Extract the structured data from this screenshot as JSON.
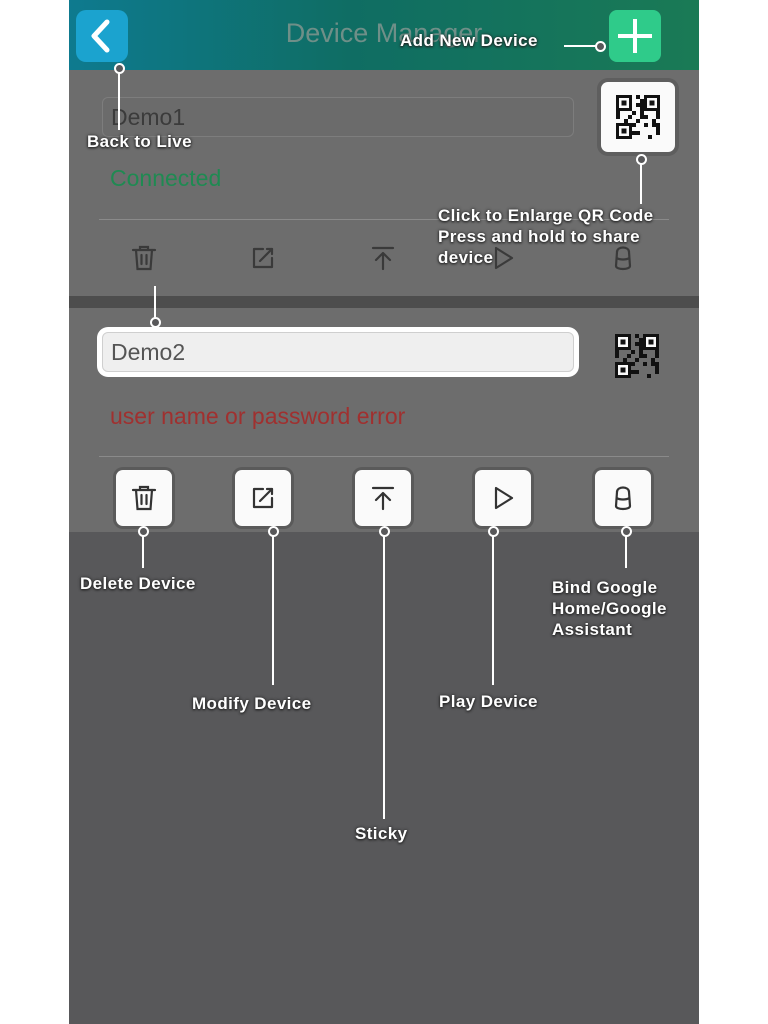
{
  "header": {
    "title": "Device Manager"
  },
  "devices": [
    {
      "name": "Demo1",
      "status": "Connected",
      "status_color": "#1f8a52"
    },
    {
      "name": "Demo2",
      "status": "user name or password error",
      "status_color": "#a0302f"
    }
  ],
  "actions": [
    {
      "name": "delete",
      "icon": "trash-icon"
    },
    {
      "name": "modify",
      "icon": "edit-icon"
    },
    {
      "name": "sticky",
      "icon": "pin-to-top-icon"
    },
    {
      "name": "play",
      "icon": "play-icon"
    },
    {
      "name": "google-home",
      "icon": "google-home-speaker-icon"
    }
  ],
  "callouts": {
    "add_new_device": "Add New Device",
    "back_to_live": "Back to Live",
    "qr_line1": "Click to Enlarge QR Code",
    "qr_line2": "Press and hold to share",
    "qr_line3": "device",
    "delete_device": "Delete Device",
    "bind_line1": "Bind Google",
    "bind_line2": "Home/Google",
    "bind_line3": "Assistant",
    "modify_device": "Modify Device",
    "play_device": "Play Device",
    "sticky": "Sticky"
  },
  "colors": {
    "header_start": "#0e7a8f",
    "add_button": "#2fcb8a",
    "back_button": "#1ba3cf",
    "panel": "#6d6d6d",
    "background": "#58585a"
  }
}
